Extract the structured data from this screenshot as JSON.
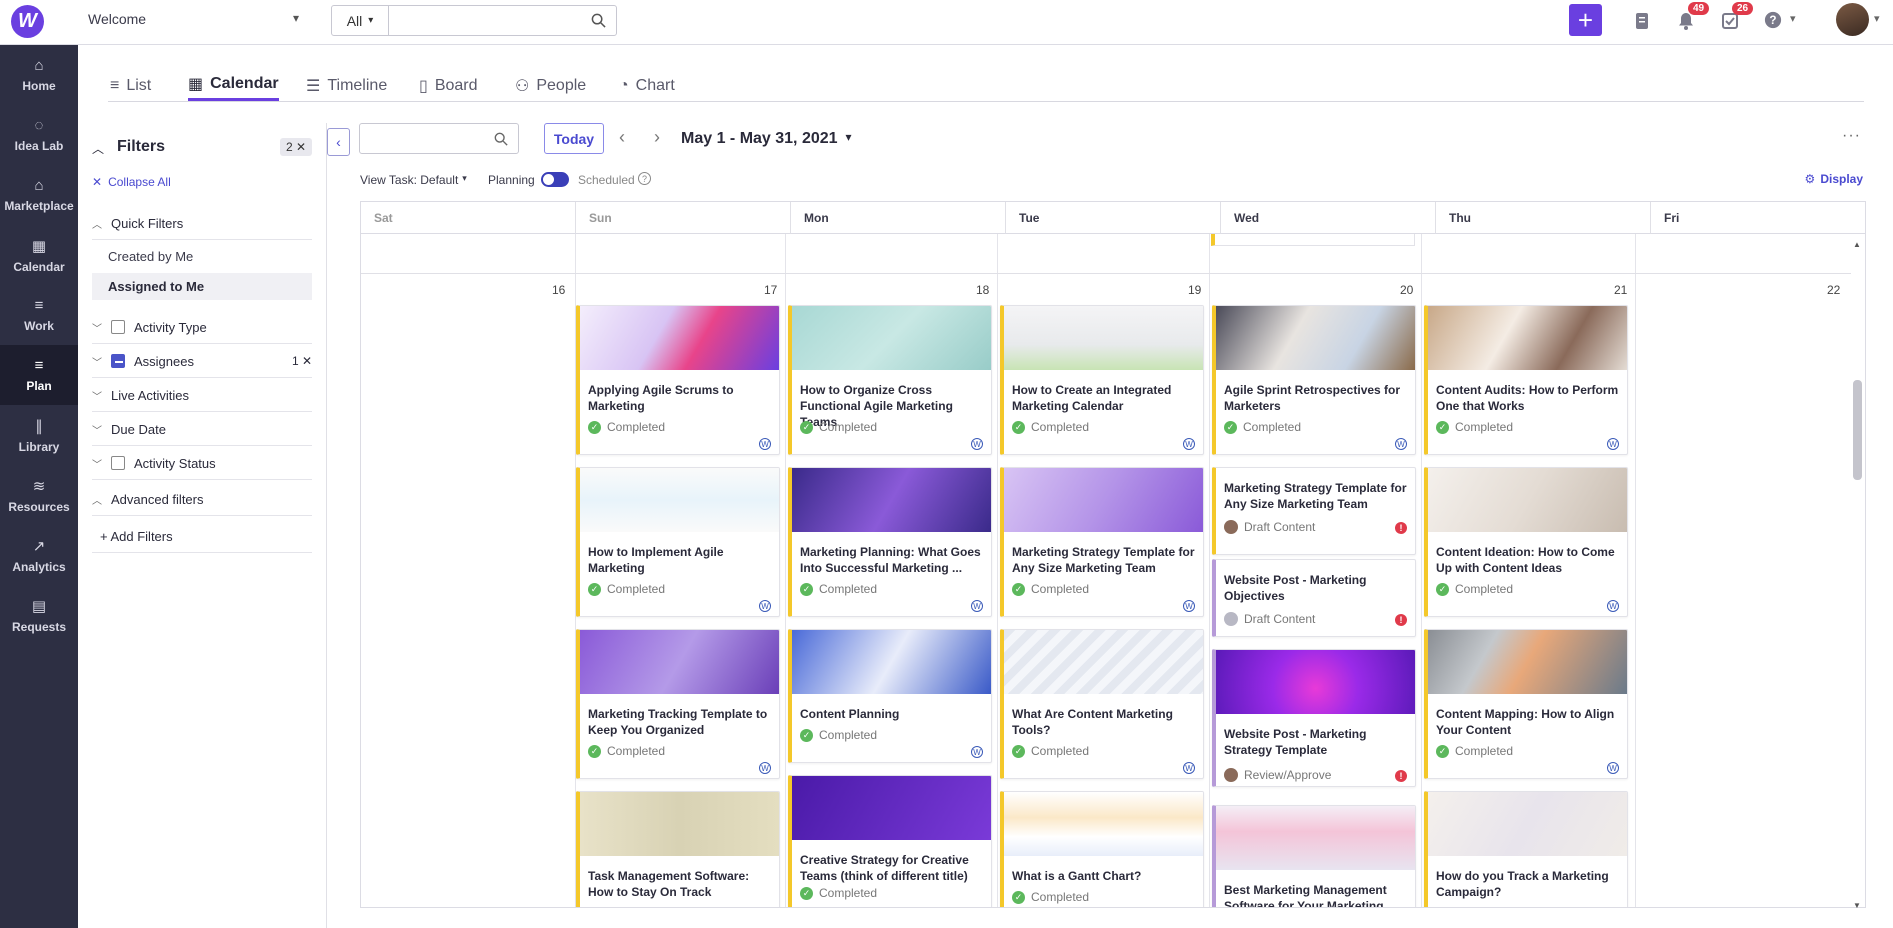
{
  "topbar": {
    "logo_letter": "W",
    "workspace": "Welcome",
    "search_scope": "All",
    "search_placeholder": "",
    "notifications_count": "49",
    "tasks_count": "26"
  },
  "nav": [
    {
      "label": "Home",
      "icon": "home-icon",
      "glyph": "⌂"
    },
    {
      "label": "Idea Lab",
      "icon": "lightbulb-icon",
      "glyph": "◌"
    },
    {
      "label": "Marketplace",
      "icon": "store-icon",
      "glyph": "⌂"
    },
    {
      "label": "Calendar",
      "icon": "calendar-icon",
      "glyph": "▦"
    },
    {
      "label": "Work",
      "icon": "list-icon",
      "glyph": "≡"
    },
    {
      "label": "Plan",
      "icon": "plan-icon",
      "glyph": "≡"
    },
    {
      "label": "Library",
      "icon": "library-icon",
      "glyph": "∥"
    },
    {
      "label": "Resources",
      "icon": "database-icon",
      "glyph": "≋"
    },
    {
      "label": "Analytics",
      "icon": "analytics-icon",
      "glyph": "↗"
    },
    {
      "label": "Requests",
      "icon": "requests-icon",
      "glyph": "▤"
    }
  ],
  "tabs": [
    {
      "label": "List",
      "glyph": "≡"
    },
    {
      "label": "Calendar",
      "glyph": "▦"
    },
    {
      "label": "Timeline",
      "glyph": "☰"
    },
    {
      "label": "Board",
      "glyph": "▯"
    },
    {
      "label": "People",
      "glyph": "⚇"
    },
    {
      "label": "Chart",
      "glyph": "◔"
    }
  ],
  "filters": {
    "title": "Filters",
    "count": "2 ✕",
    "collapse_all": "Collapse All",
    "quick_filters": "Quick Filters",
    "created_by_me": "Created by Me",
    "assigned_to_me": "Assigned to Me",
    "activity_type": "Activity Type",
    "assignees": "Assignees",
    "assignees_count": "1 ✕",
    "live_activities": "Live Activities",
    "due_date": "Due Date",
    "activity_status": "Activity Status",
    "advanced_filters": "Advanced filters",
    "add_filters": "+ Add Filters"
  },
  "toolbar": {
    "today": "Today",
    "date_range": "May 1 - May 31, 2021",
    "view_task": "View Task: Default",
    "planning": "Planning",
    "scheduled": "Scheduled",
    "display": "Display"
  },
  "days": [
    "Sat",
    "Sun",
    "Mon",
    "Tue",
    "Wed",
    "Thu",
    "Fri"
  ],
  "dates": [
    "16",
    "17",
    "18",
    "19",
    "20",
    "21",
    "22"
  ],
  "cards": {
    "sun": [
      {
        "title": "Applying Agile Scrums to Marketing",
        "status": "Completed"
      },
      {
        "title": "How to Implement Agile Marketing",
        "status": "Completed"
      },
      {
        "title": "Marketing Tracking Template to Keep You Organized",
        "status": "Completed"
      },
      {
        "title": "Task Management Software: How to Stay On Track",
        "status": ""
      }
    ],
    "mon": [
      {
        "title": "How to Organize Cross Functional Agile Marketing Teams",
        "status": "Completed"
      },
      {
        "title": "Marketing Planning: What Goes Into Successful Marketing ...",
        "status": "Completed"
      },
      {
        "title": "Content Planning",
        "status": "Completed"
      },
      {
        "title": "Creative Strategy for Creative Teams (think of different title)",
        "status": "Completed"
      }
    ],
    "tue": [
      {
        "title": "How to Create an Integrated Marketing Calendar",
        "status": "Completed"
      },
      {
        "title": "Marketing Strategy Template for Any Size Marketing Team",
        "status": "Completed"
      },
      {
        "title": "What Are Content Marketing Tools?",
        "status": "Completed"
      },
      {
        "title": "What is a Gantt Chart?",
        "status": "Completed"
      }
    ],
    "wed": [
      {
        "title": "Agile Sprint Retrospectives for Marketers",
        "status": "Completed"
      },
      {
        "title": "Marketing Strategy Template for Any Size Marketing Team",
        "status": "Draft Content"
      },
      {
        "title": "Website Post - Marketing Objectives",
        "status": "Draft Content"
      },
      {
        "title": "Website Post - Marketing Strategy Template",
        "status": "Review/Approve"
      },
      {
        "title": "Best Marketing Management Software for Your Marketing",
        "status": ""
      }
    ],
    "thu": [
      {
        "title": "Content Audits: How to Perform One that Works",
        "status": "Completed"
      },
      {
        "title": "Content Ideation: How to Come Up with Content Ideas",
        "status": "Completed"
      },
      {
        "title": "Content Mapping: How to Align Your Content",
        "status": "Completed"
      },
      {
        "title": "How do you Track a Marketing Campaign?",
        "status": ""
      }
    ]
  },
  "colors": {
    "accent": "#6a3fe0",
    "nav_bg": "#2d2f43",
    "card_stripe": "#f4c82a",
    "ok": "#5cb85c",
    "alert": "#e03a4a"
  }
}
